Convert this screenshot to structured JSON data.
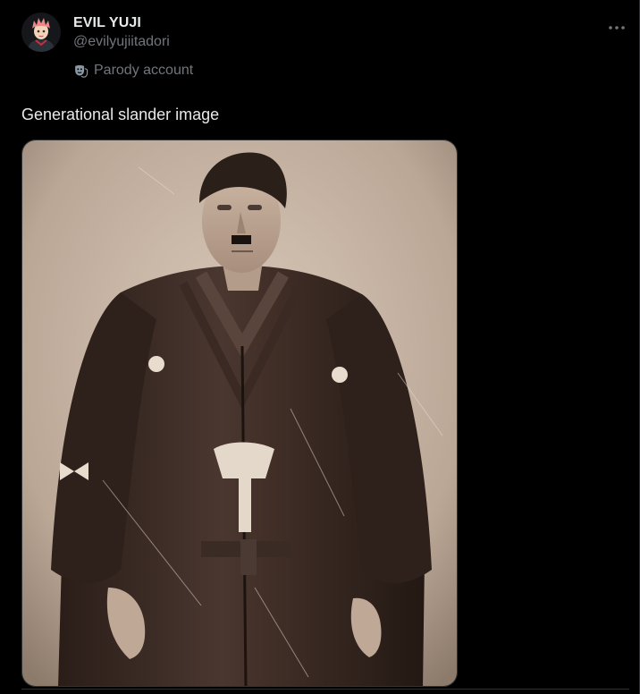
{
  "tweet": {
    "display_name": "EVIL YUJI",
    "handle": "@evilyujiitadori",
    "account_label": "Parody account",
    "text": "Generational slander image",
    "more_icon": "more-horizontal-icon",
    "label_icon": "theater-mask-icon"
  },
  "media": {
    "type": "sepia-photo"
  },
  "colors": {
    "background": "#000000",
    "primary_text": "#e7e9ea",
    "secondary_text": "#71767b",
    "border": "#2f3336"
  }
}
